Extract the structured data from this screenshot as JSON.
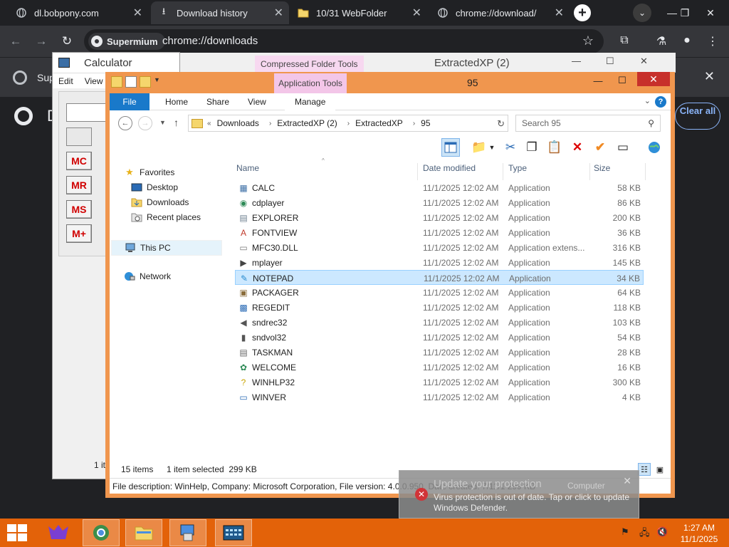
{
  "browser": {
    "tabs": [
      {
        "title": "dl.bobpony.com",
        "active": false,
        "icon": "globe-icon"
      },
      {
        "title": "Download history",
        "active": true,
        "icon": "download-icon"
      },
      {
        "title": "10/31 WebFolder",
        "active": false,
        "icon": "folder-icon"
      },
      {
        "title": "chrome://download/",
        "active": false,
        "icon": "globe-icon"
      }
    ],
    "new_tab": "+",
    "chip_label": "Supermium",
    "url": "chrome://downloads",
    "infobar_text": "Sup",
    "page_heading_initial": "D",
    "clear_all": "Clear all"
  },
  "calculator": {
    "title": "Calculator",
    "menu": [
      "Edit",
      "View"
    ],
    "memory_keys": [
      "MC",
      "MR",
      "MS",
      "M+"
    ],
    "status_fragment": "1 it"
  },
  "compressed_window": {
    "context_tab": "Compressed Folder Tools",
    "title": "ExtractedXP (2)"
  },
  "explorer": {
    "title": "95",
    "context_tab": "Application Tools",
    "ribbon_tabs": [
      "File",
      "Home",
      "Share",
      "View",
      "Manage"
    ],
    "breadcrumb": [
      "Downloads",
      "ExtractedXP (2)",
      "ExtractedXP",
      "95"
    ],
    "search_placeholder": "Search 95",
    "nav": {
      "favorites": "Favorites",
      "desktop": "Desktop",
      "downloads": "Downloads",
      "recent": "Recent places",
      "this_pc": "This PC",
      "network": "Network"
    },
    "columns": {
      "name": "Name",
      "date": "Date modified",
      "type": "Type",
      "size": "Size"
    },
    "files": [
      {
        "name": "CALC",
        "date": "11/1/2025 12:02 AM",
        "type": "Application",
        "size": "58 KB",
        "icon": "calculator-icon"
      },
      {
        "name": "cdplayer",
        "date": "11/1/2025 12:02 AM",
        "type": "Application",
        "size": "86 KB",
        "icon": "cd-icon"
      },
      {
        "name": "EXPLORER",
        "date": "11/1/2025 12:02 AM",
        "type": "Application",
        "size": "200 KB",
        "icon": "explorer-icon"
      },
      {
        "name": "FONTVIEW",
        "date": "11/1/2025 12:02 AM",
        "type": "Application",
        "size": "36 KB",
        "icon": "font-icon"
      },
      {
        "name": "MFC30.DLL",
        "date": "11/1/2025 12:02 AM",
        "type": "Application extens...",
        "size": "316 KB",
        "icon": "dll-icon"
      },
      {
        "name": "mplayer",
        "date": "11/1/2025 12:02 AM",
        "type": "Application",
        "size": "145 KB",
        "icon": "media-icon"
      },
      {
        "name": "NOTEPAD",
        "date": "11/1/2025 12:02 AM",
        "type": "Application",
        "size": "34 KB",
        "icon": "notepad-icon",
        "selected": true
      },
      {
        "name": "PACKAGER",
        "date": "11/1/2025 12:02 AM",
        "type": "Application",
        "size": "64 KB",
        "icon": "package-icon"
      },
      {
        "name": "REGEDIT",
        "date": "11/1/2025 12:02 AM",
        "type": "Application",
        "size": "118 KB",
        "icon": "registry-icon"
      },
      {
        "name": "sndrec32",
        "date": "11/1/2025 12:02 AM",
        "type": "Application",
        "size": "103 KB",
        "icon": "speaker-icon"
      },
      {
        "name": "sndvol32",
        "date": "11/1/2025 12:02 AM",
        "type": "Application",
        "size": "54 KB",
        "icon": "volume-icon"
      },
      {
        "name": "TASKMAN",
        "date": "11/1/2025 12:02 AM",
        "type": "Application",
        "size": "28 KB",
        "icon": "task-icon"
      },
      {
        "name": "WELCOME",
        "date": "11/1/2025 12:02 AM",
        "type": "Application",
        "size": "16 KB",
        "icon": "welcome-icon"
      },
      {
        "name": "WINHLP32",
        "date": "11/1/2025 12:02 AM",
        "type": "Application",
        "size": "300 KB",
        "icon": "help-icon"
      },
      {
        "name": "WINVER",
        "date": "11/1/2025 12:02 AM",
        "type": "Application",
        "size": "4 KB",
        "icon": "window-icon"
      }
    ],
    "status_items": "15 items",
    "status_selected": "1 item selected  299 KB",
    "description": "File description: WinHelp, Company: Microsoft Corporation, File version: 4.0.0.950, Date created: 7/11/1 299 KB"
  },
  "toast": {
    "title": "Update your protection",
    "source": "Computer",
    "body_line1": "Virus protection is out of date. Tap or click to update",
    "body_line2": "Windows Defender."
  },
  "taskbar": {
    "time": "1:27 AM",
    "date": "11/1/2025"
  },
  "colors": {
    "explorer_frame": "#f0964e",
    "taskbar": "#e36209",
    "file_tab": "#1979ca",
    "selection": "#cce8ff"
  }
}
